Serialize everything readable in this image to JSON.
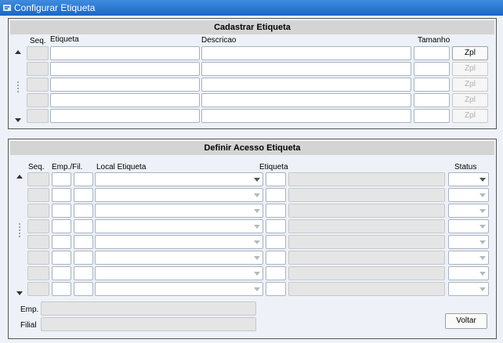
{
  "window": {
    "title": "Configurar Etiqueta"
  },
  "cadastrar": {
    "title": "Cadastrar Etiqueta",
    "headers": {
      "seq": "Seq.",
      "etiqueta": "Etiqueta",
      "descricao": "Descricao",
      "tamanho": "Tamanho"
    },
    "zpl_label": "Zpl",
    "rows": 5
  },
  "acesso": {
    "title": "Definir Acesso Etiqueta",
    "headers": {
      "seq": "Seq.",
      "emp_fil": "Emp./Fil.",
      "local": "Local Etiqueta",
      "etiqueta": "Etiqueta",
      "status": "Status"
    },
    "rows": 8
  },
  "footer": {
    "emp_label": "Emp.",
    "filial_label": "Filial",
    "voltar_label": "Voltar"
  }
}
